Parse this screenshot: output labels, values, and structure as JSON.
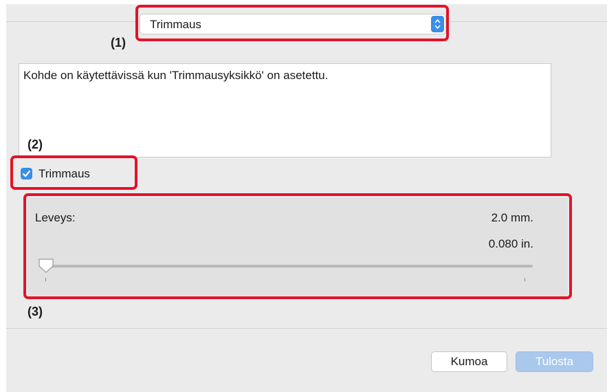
{
  "popup": {
    "selected": "Trimmaus"
  },
  "callouts": {
    "c1": "(1)",
    "c2": "(2)",
    "c3": "(3)"
  },
  "description": {
    "text": "Kohde on käytettävissä kun 'Trimmausyksikkö' on asetettu."
  },
  "trim": {
    "label": "Trimmaus",
    "checked": true
  },
  "width": {
    "label": "Leveys:",
    "value_mm": "2.0 mm.",
    "value_in": "0.080 in.",
    "slider_level": 0
  },
  "buttons": {
    "cancel": "Kumoa",
    "print": "Tulosta"
  },
  "colors": {
    "callout": "#e3122a",
    "accent": "#3a8ee5",
    "print_button": "#a9c8ec"
  },
  "icons": {
    "popup_stepper": "up-down-chevron-icon",
    "checkbox": "checkmark-icon",
    "slider": "slider-thumb-icon"
  }
}
